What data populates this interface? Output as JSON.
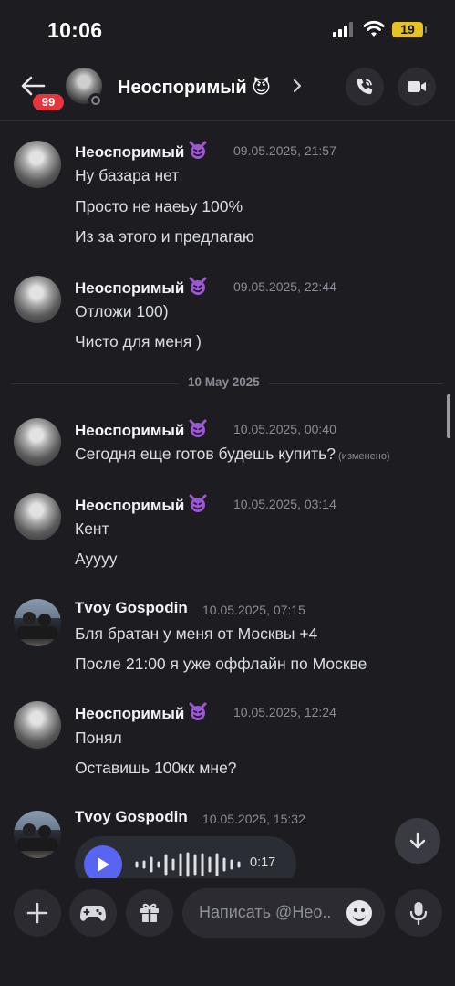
{
  "status_bar": {
    "time": "10:06",
    "battery": "19"
  },
  "header": {
    "unread_badge": "99",
    "title": "Неоспоримый 😈"
  },
  "colors": {
    "accent": "#5865f2",
    "badge": "#e5353e",
    "background": "#1c1c21",
    "battery": "#e6c224"
  },
  "messages": [
    {
      "author": "Неоспоримый",
      "timestamp": "09.05.2025, 21:57",
      "lines": [
        "Ну базара нет",
        "Просто не наеьу 100%",
        "Из за этого и предлагаю"
      ]
    },
    {
      "author": "Неоспоримый",
      "timestamp": "09.05.2025, 22:44",
      "lines": [
        "Отложи 100)",
        "Чисто для меня )"
      ]
    },
    {
      "author": "Неоспоримый",
      "timestamp": "10.05.2025, 00:40",
      "lines": [
        "Сегодня  еще готов будешь купить?"
      ],
      "edited": "(изменено)"
    },
    {
      "author": "Неоспоримый",
      "timestamp": "10.05.2025, 03:14",
      "lines": [
        "Кент",
        "Ауууу"
      ]
    },
    {
      "author": "Tvoy Gospodin",
      "timestamp": "10.05.2025, 07:15",
      "lines": [
        "Бля братан у меня от Москвы +4",
        "После 21:00 я уже оффлайн по Москве"
      ]
    },
    {
      "author": "Неоспоримый",
      "timestamp": "10.05.2025, 12:24",
      "lines": [
        "Понял",
        "Оставишь 100кк мне?"
      ]
    },
    {
      "author": "Tvoy Gospodin",
      "timestamp": "10.05.2025, 15:32",
      "voice": {
        "duration": "0:17"
      }
    }
  ],
  "date_divider": "10 May 2025",
  "composer": {
    "placeholder": "Написать @Нео.."
  },
  "icons": [
    "back-arrow-icon",
    "voice-call-icon",
    "video-call-icon",
    "devil-emoji-icon",
    "play-icon",
    "scroll-down-arrow-icon",
    "plus-icon",
    "gamepad-icon",
    "gift-icon",
    "emoji-icon",
    "microphone-icon"
  ]
}
